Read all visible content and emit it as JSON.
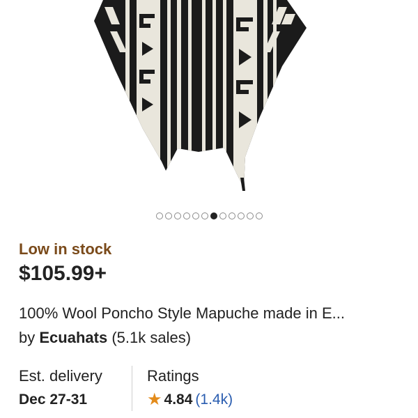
{
  "product": {
    "image_alt": "Black and white patterned wool poncho",
    "carousel": {
      "total": 12,
      "active_index": 6
    },
    "stock_status": "Low in stock",
    "price": "$105.99+",
    "title": "100% Wool Poncho Style Mapuche made in E...",
    "seller": {
      "prefix": "by",
      "name": "Ecuahats",
      "sales": "(5.1k sales)"
    },
    "delivery": {
      "label": "Est. delivery",
      "value": "Dec 27-31"
    },
    "ratings": {
      "label": "Ratings",
      "star_icon": "star-icon",
      "score": "4.84",
      "count": "(1.4k)"
    }
  },
  "colors": {
    "stock_text": "#7a4a1a",
    "star": "#e38b1b",
    "link": "#2a5db0"
  }
}
